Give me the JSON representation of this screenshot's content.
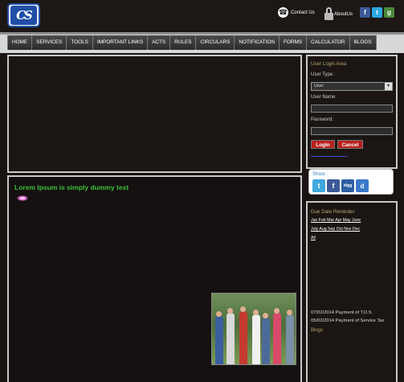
{
  "header": {
    "logo_text": "CS",
    "contact_label": "Contact Us",
    "about_label": "AboutUs",
    "social": [
      "f",
      "t",
      "g"
    ]
  },
  "nav": [
    "HOME",
    "SERVICES",
    "TOOLS",
    "IMPORTANT LINKS",
    "ACTS",
    "RULES",
    "CIRCULARS",
    "NOTIFICATION",
    "FORMS",
    "CALCULATOR",
    "BLOGS"
  ],
  "main": {
    "headline": "Lorem Ipsum is simply dummy text"
  },
  "login": {
    "title": "User Login Area",
    "user_type_label": "User Type :",
    "user_type_value": "User",
    "user_name_label": "User Name:",
    "password_label": "Password:",
    "login_button": "Login",
    "cancel_button": "Cancel"
  },
  "share": {
    "title": "Share :",
    "icons": [
      "t",
      "f",
      "digg",
      "d"
    ]
  },
  "due": {
    "title": "Due Date Reminder",
    "months_row1": "Jan Feb Mar Apr May June",
    "months_row2": "July Aug Sep Oct Nov Dec",
    "months_row3": "All",
    "reminder1": "07/02/2014 Payment of T.D.S",
    "reminder2": "05/02/2014 Payment of Service Tax",
    "blogs": "Blogs"
  },
  "colors": {
    "headline": "#3fbf3a",
    "button_red": "#b8201c",
    "panel_border": "#c8c8c8",
    "logo_blue": "#1f4fa5"
  }
}
